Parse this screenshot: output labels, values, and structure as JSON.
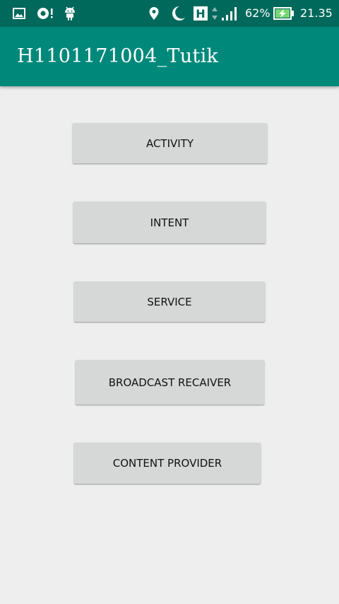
{
  "status_bar": {
    "icons_left": [
      "image-icon",
      "sync-alert-icon",
      "android-icon"
    ],
    "icons_right": [
      "location-icon",
      "moon-icon",
      "h-network-icon",
      "signal-icon"
    ],
    "battery_percent": "62%",
    "battery_level": 0.62,
    "time": "21.35"
  },
  "app_bar": {
    "title": "H1101171004_Tutik",
    "color": "#00897b"
  },
  "buttons": {
    "activity": "ACTIVITY",
    "intent": "INTENT",
    "service": "SERVICE",
    "broadcast_receiver": "BROADCAST RECAIVER",
    "content_provider": "CONTENT PROVIDER"
  },
  "colors": {
    "status_bar": "#00695c",
    "background": "#eeeeee",
    "button": "#d6d7d7",
    "battery_charging": "#76d672"
  }
}
